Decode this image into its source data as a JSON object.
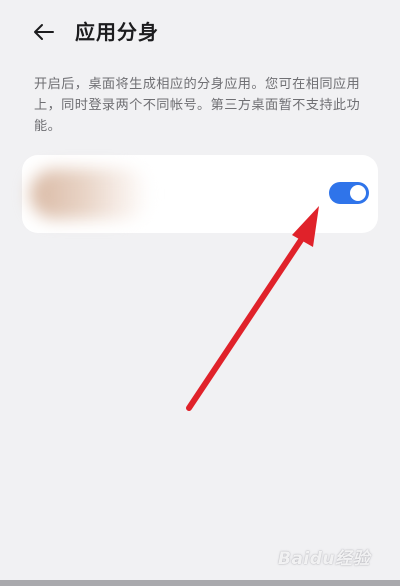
{
  "header": {
    "title": "应用分身",
    "back_icon": "arrow-left-icon"
  },
  "description": "开启后，桌面将生成相应的分身应用。您可在相同应用上，同时登录两个不同帐号。第三方桌面暂不支持此功能。",
  "app_row": {
    "toggle_state": "on",
    "toggle_color": "#2f74ea"
  },
  "annotation": {
    "arrow_color": "#e0222a"
  },
  "watermark": {
    "text": "Baidu经验"
  }
}
